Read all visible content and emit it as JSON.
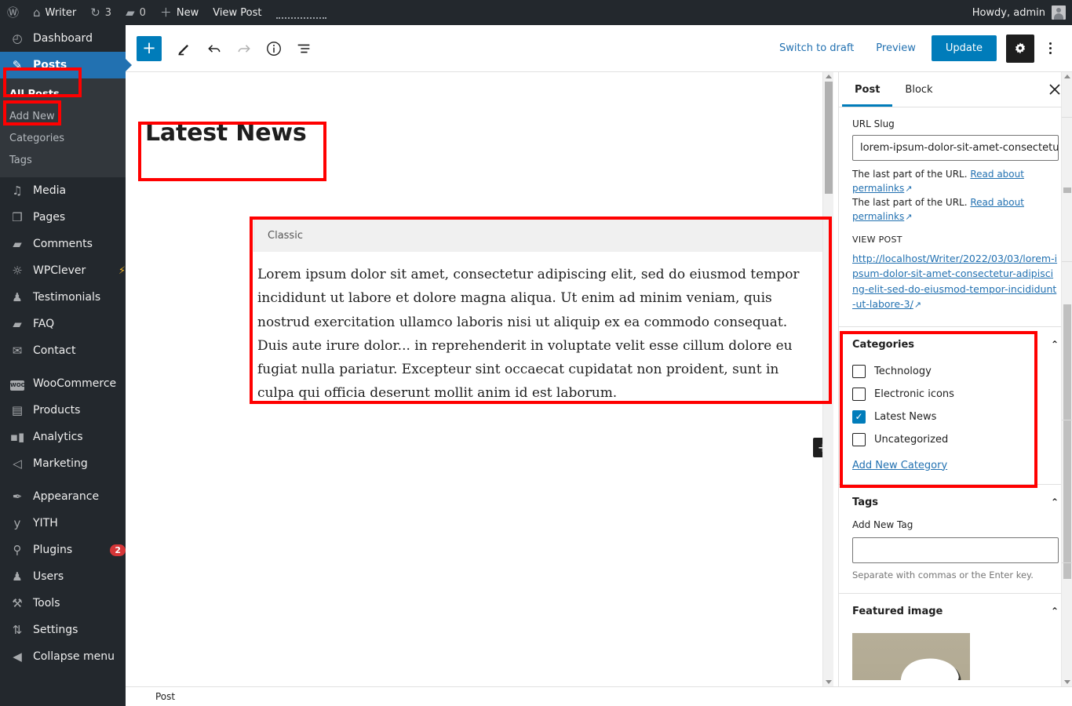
{
  "adminbar": {
    "logo_icon": "wordpress-logo-icon",
    "site_icon": "home-icon",
    "site_name": "Writer",
    "updates_icon": "updates-icon",
    "updates_count": "3",
    "comments_icon": "comment-icon",
    "comments_count": "0",
    "new_icon": "plus-icon",
    "new_label": "New",
    "view_post_label": "View Post",
    "howdy": "Howdy, admin"
  },
  "sidebar": {
    "items": [
      {
        "label": "Dashboard",
        "icon": "dashboard-icon",
        "glyph": "◴"
      },
      {
        "label": "Posts",
        "icon": "pin-icon",
        "glyph": "✎"
      },
      {
        "label": "Media",
        "icon": "media-icon",
        "glyph": "♫"
      },
      {
        "label": "Pages",
        "icon": "pages-icon",
        "glyph": "❒"
      },
      {
        "label": "Comments",
        "icon": "comment-icon",
        "glyph": "❑"
      },
      {
        "label": "WPClever",
        "icon": "lightbulb-icon",
        "glyph": "☼",
        "suffix": "⚡"
      },
      {
        "label": "Testimonials",
        "icon": "user-icon",
        "glyph": "♟"
      },
      {
        "label": "FAQ",
        "icon": "folder-icon",
        "glyph": "▰"
      },
      {
        "label": "Contact",
        "icon": "envelope-icon",
        "glyph": "✉"
      },
      {
        "label": "WooCommerce",
        "icon": "woocommerce-icon",
        "glyph": "WOO"
      },
      {
        "label": "Products",
        "icon": "products-icon",
        "glyph": "▤"
      },
      {
        "label": "Analytics",
        "icon": "bar-chart-icon",
        "glyph": "▮"
      },
      {
        "label": "Marketing",
        "icon": "megaphone-icon",
        "glyph": "📣"
      },
      {
        "label": "Appearance",
        "icon": "paintbrush-icon",
        "glyph": "✒"
      },
      {
        "label": "YITH",
        "icon": "yith-icon",
        "glyph": "y"
      },
      {
        "label": "Plugins",
        "icon": "plug-icon",
        "glyph": "⚲",
        "badge": "2"
      },
      {
        "label": "Users",
        "icon": "users-icon",
        "glyph": "♟"
      },
      {
        "label": "Tools",
        "icon": "wrench-icon",
        "glyph": "🔧"
      },
      {
        "label": "Settings",
        "icon": "sliders-icon",
        "glyph": "⇅"
      },
      {
        "label": "Collapse menu",
        "icon": "collapse-icon",
        "glyph": "◀"
      }
    ],
    "submenu": [
      {
        "label": "All Posts"
      },
      {
        "label": "Add New"
      },
      {
        "label": "Categories"
      },
      {
        "label": "Tags"
      }
    ]
  },
  "toolbar": {
    "add_block_label": "+",
    "tools_icon": "pencil-icon",
    "undo_icon": "undo-icon",
    "redo_icon": "redo-icon",
    "details_icon": "info-icon",
    "list_view_icon": "list-view-icon",
    "switch_to_draft": "Switch to draft",
    "preview": "Preview",
    "update": "Update",
    "settings_icon": "gear-icon",
    "options_icon": "more-options-icon"
  },
  "editor": {
    "post_title": "Latest News",
    "block_name": "Classic",
    "block_text": "Lorem ipsum dolor sit amet, consectetur adipiscing elit, sed do eiusmod tempor incididunt ut labore et dolore magna aliqua. Ut enim ad minim veniam, quis nostrud exercitation ullamco laboris nisi ut aliquip ex ea commodo consequat. Duis aute irure dolor... in reprehenderit in voluptate velit esse cillum dolore eu fugiat nulla pariatur. Excepteur sint occaecat cupidatat non proident, sunt in culpa qui officia deserunt mollit anim id est laborum.",
    "inserter_label": "+",
    "breadcrumb": "Post"
  },
  "settings": {
    "tabs": [
      {
        "label": "Post"
      },
      {
        "label": "Block"
      }
    ],
    "close_icon": "close-icon",
    "url_slug_label": "URL Slug",
    "url_slug_value": "lorem-ipsum-dolor-sit-amet-consectetu",
    "help_prefix": "The last part of the URL.",
    "help_link": "Read about permalinks",
    "external_icon": "external-link-icon",
    "view_post_label": "VIEW POST",
    "permalink": "http://localhost/Writer/2022/03/03/lorem-ipsum-dolor-sit-amet-consectetur-adipiscing-elit-sed-do-eiusmod-tempor-incididunt-ut-labore-3/",
    "categories": {
      "title": "Categories",
      "collapse_icon": "chevron-up-icon",
      "items": [
        {
          "label": "Technology",
          "checked": false
        },
        {
          "label": "Electronic icons",
          "checked": false
        },
        {
          "label": "Latest News",
          "checked": true
        },
        {
          "label": "Uncategorized",
          "checked": false
        }
      ],
      "add_new": "Add New Category"
    },
    "tags": {
      "title": "Tags",
      "collapse_icon": "chevron-up-icon",
      "field_label": "Add New Tag",
      "value": "",
      "help": "Separate with commas or the Enter key."
    },
    "featured_image": {
      "title": "Featured image",
      "collapse_icon": "chevron-up-icon"
    }
  },
  "colors": {
    "admin_dark": "#23282d",
    "accent_blue": "#007cba",
    "current_blue": "#2271b1",
    "link_blue": "#2271b1",
    "badge_red": "#d63638",
    "annotation_red": "#ff0000"
  }
}
